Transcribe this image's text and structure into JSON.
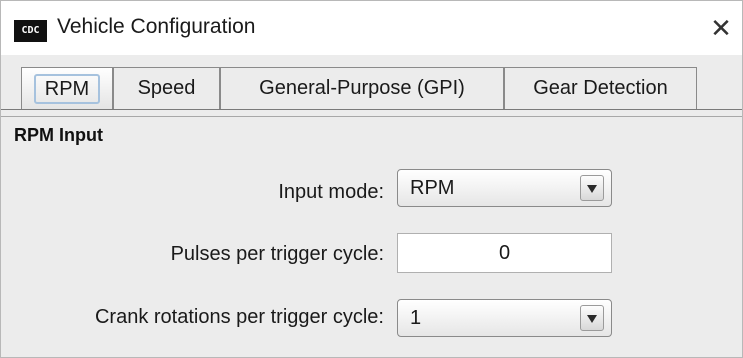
{
  "window": {
    "title": "Vehicle Configuration",
    "app_icon_text": "CDC",
    "close_glyph": "✕",
    "icons": [
      "app-logo-icon",
      "close-icon"
    ]
  },
  "tabs": [
    {
      "label": "RPM",
      "selected": true
    },
    {
      "label": "Speed",
      "selected": false
    },
    {
      "label": "General-Purpose (GPI)",
      "selected": false
    },
    {
      "label": "Gear Detection",
      "selected": false
    }
  ],
  "rpm_input": {
    "section_title": "RPM Input",
    "input_mode": {
      "label": "Input mode:",
      "value": "RPM",
      "icon": "chevron-down-icon"
    },
    "pulses_per_trigger_cycle": {
      "label": "Pulses per trigger cycle:",
      "value": "0"
    },
    "crank_rotations_per_trigger_cycle": {
      "label": "Crank rotations per trigger cycle:",
      "value": "1",
      "icon": "chevron-down-icon"
    }
  },
  "colors": {
    "window_bg": "#ececec",
    "titlebar_bg": "#ffffff",
    "tab_focus": "#a6c2de"
  }
}
